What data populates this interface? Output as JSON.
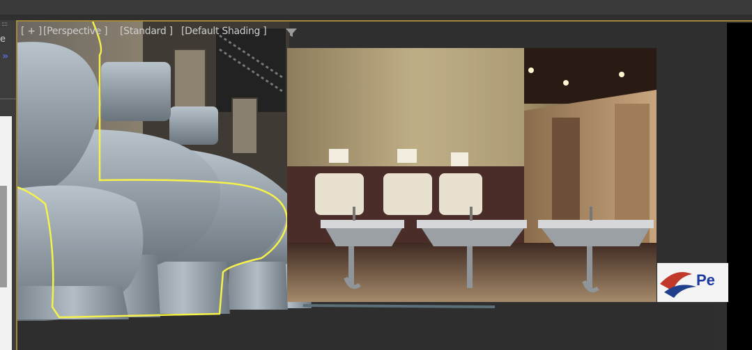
{
  "viewport": {
    "labels": [
      "[ + ]",
      "[Perspective ]",
      "[Standard ]",
      "[Default Shading ]"
    ],
    "filter_icon": "funnel-icon",
    "selection_color": "#f6f24a",
    "border_color": "#a4883a"
  },
  "left_panel": {
    "dots": "::::",
    "letter": "e",
    "arrows": "»"
  },
  "logo": {
    "text": "Pe"
  }
}
